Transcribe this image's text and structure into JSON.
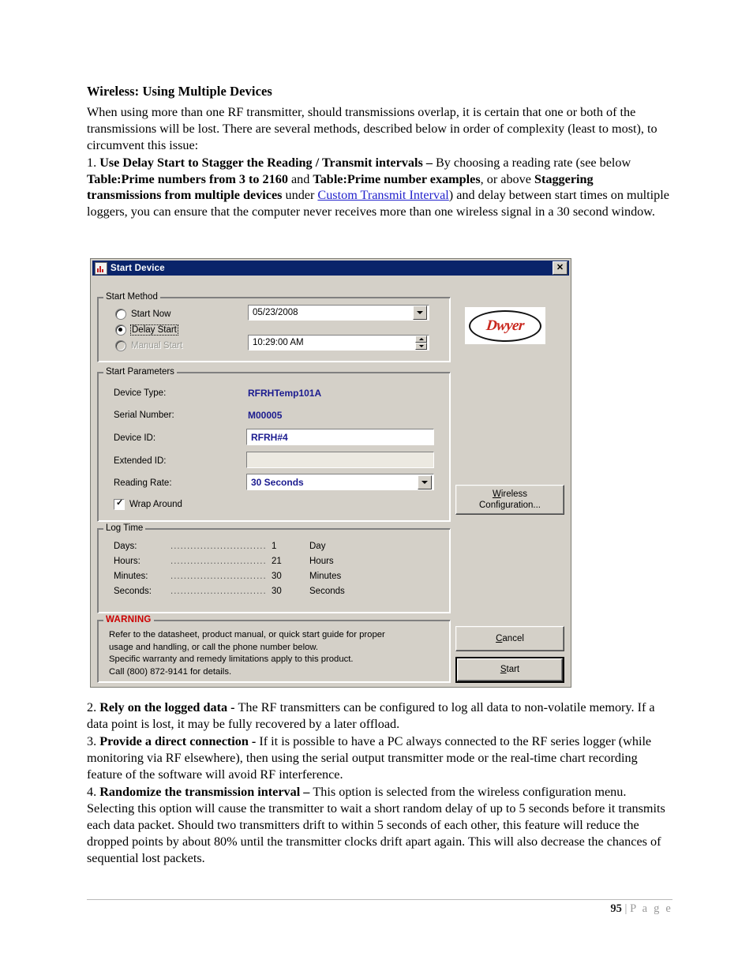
{
  "document": {
    "heading": "Wireless: Using Multiple Devices",
    "intro": "When using more than one RF transmitter, should transmissions overlap, it is certain that one or both of the transmissions will be lost. There are several methods, described below in order of complexity (least to most), to circumvent this issue:",
    "item1": {
      "number": "1. ",
      "bold_lead": "Use Delay Start to Stagger the Reading / Transmit intervals – ",
      "text_a": "By choosing a reading rate (see below ",
      "bold_b": "Table:Prime numbers from 3 to 2160",
      "text_c": " and ",
      "bold_d": "Table:Prime number examples",
      "text_e": ", or above ",
      "bold_f": "Staggering transmissions from multiple devices",
      "text_g": " under ",
      "link": "Custom Transmit Interval",
      "text_h": ") and delay between start times on multiple loggers, you can ensure that the computer never receives more than one wireless signal in a 30 second window."
    },
    "item2": {
      "number": "2. ",
      "bold_lead": "Rely on the logged data - ",
      "text": "The RF transmitters can be configured to log all data to non-volatile memory. If a data point is lost, it may be fully recovered by a later offload."
    },
    "item3": {
      "number": "3. ",
      "bold_lead": "Provide a direct connection - ",
      "text": "If it is possible to have a PC always connected to the RF series logger (while monitoring via RF elsewhere), then using the serial output transmitter mode or the real-time chart recording feature of the software will avoid RF interference."
    },
    "item4": {
      "number": "4. ",
      "bold_lead": "Randomize the transmission interval – ",
      "text": "This option is selected from the wireless configuration menu. Selecting this option will cause the transmitter to wait a short random delay of up to 5 seconds before it transmits each data packet. Should two transmitters drift to within 5 seconds of each other, this feature will reduce the dropped points by about 80% until the transmitter clocks drift apart again. This will also decrease the chances of sequential lost packets."
    },
    "footer": {
      "page_number": "95",
      "separator": " | ",
      "page_word": "P a g e"
    }
  },
  "dialog": {
    "title": "Start Device",
    "title_icon": "chart-icon",
    "close_label": "✕",
    "colors": {
      "titlebar": "#0a246a",
      "face": "#d4d0c8",
      "value_text": "#1b1b8f",
      "warning": "#cc0000",
      "link": "#2222cc"
    },
    "start_method": {
      "legend": "Start Method",
      "options": [
        {
          "label": "Start Now",
          "selected": false,
          "disabled": false
        },
        {
          "label": "Delay Start",
          "selected": true,
          "disabled": false
        },
        {
          "label": "Manual Start",
          "selected": false,
          "disabled": true
        }
      ],
      "date_value": "05/23/2008",
      "time_value": "10:29:00 AM"
    },
    "start_parameters": {
      "legend": "Start Parameters",
      "device_type_label": "Device Type:",
      "device_type_value": "RFRHTemp101A",
      "serial_number_label": "Serial Number:",
      "serial_number_value": "M00005",
      "device_id_label": "Device ID:",
      "device_id_value": "RFRH#4",
      "extended_id_label": "Extended ID:",
      "extended_id_value": "",
      "reading_rate_label": "Reading Rate:",
      "reading_rate_value": "30 Seconds",
      "wrap_around_label": "Wrap Around",
      "wrap_around_checked": true
    },
    "log_time": {
      "legend": "Log Time",
      "dots": "......................................",
      "rows": [
        {
          "name": "Days:",
          "value": "1",
          "unit": "Day"
        },
        {
          "name": "Hours:",
          "value": "21",
          "unit": "Hours"
        },
        {
          "name": "Minutes:",
          "value": "30",
          "unit": "Minutes"
        },
        {
          "name": "Seconds:",
          "value": "30",
          "unit": "Seconds"
        }
      ]
    },
    "warning": {
      "legend": "WARNING",
      "line1": "Refer to the datasheet, product manual, or quick start guide for proper",
      "line2": "usage and handling, or call the phone number below.",
      "line3": "Specific warranty and remedy limitations apply to this product.",
      "line4": "Call (800) 872-9141 for details."
    },
    "logo": {
      "text": "Dwyer",
      "registered": "®"
    },
    "buttons": {
      "wireless_acc": "W",
      "wireless_rest": "ireless",
      "wireless_line2": "Configuration...",
      "cancel_acc": "C",
      "cancel_rest": "ancel",
      "start_acc": "S",
      "start_rest": "tart"
    }
  }
}
